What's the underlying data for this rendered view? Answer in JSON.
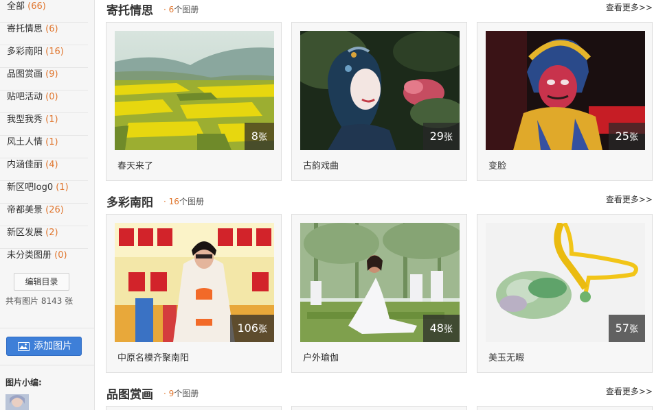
{
  "sidebar": {
    "categories": [
      {
        "label": "全部",
        "count": "(66)"
      },
      {
        "label": "寄托情思",
        "count": "(6)"
      },
      {
        "label": "多彩南阳",
        "count": "(16)"
      },
      {
        "label": "品图赏画",
        "count": "(9)"
      },
      {
        "label": "贴吧活动",
        "count": "(0)"
      },
      {
        "label": "我型我秀",
        "count": "(1)"
      },
      {
        "label": "风土人情",
        "count": "(1)"
      },
      {
        "label": "内涵佳丽",
        "count": "(4)"
      },
      {
        "label": "新区吧log0",
        "count": "(1)"
      },
      {
        "label": "帝都美景",
        "count": "(26)"
      },
      {
        "label": "新区发展",
        "count": "(2)"
      },
      {
        "label": "未分类图册",
        "count": "(0)"
      }
    ],
    "edit_label": "编辑目录",
    "total_text": "共有图片 8143 张",
    "add_label": "添加图片",
    "editor_title": "图片小编:"
  },
  "sections": [
    {
      "title": "寄托情思",
      "dot": "·",
      "count": "6",
      "count_suffix": "个图册",
      "more": "查看更多>>",
      "albums": [
        {
          "caption": "春天来了",
          "photos": "8",
          "unit": "张",
          "scene": "field"
        },
        {
          "caption": "古韵戏曲",
          "photos": "29",
          "unit": "张",
          "scene": "opera"
        },
        {
          "caption": "变脸",
          "photos": "25",
          "unit": "张",
          "scene": "mask"
        }
      ]
    },
    {
      "title": "多彩南阳",
      "dot": "·",
      "count": "16",
      "count_suffix": "个图册",
      "more": "查看更多>>",
      "albums": [
        {
          "caption": "中原名模齐聚南阳",
          "photos": "106",
          "unit": "张",
          "scene": "stage"
        },
        {
          "caption": "户外瑜伽",
          "photos": "48",
          "unit": "张",
          "scene": "yoga"
        },
        {
          "caption": "美玉无暇",
          "photos": "57",
          "unit": "张",
          "scene": "jade"
        }
      ]
    },
    {
      "title": "品图赏画",
      "dot": "·",
      "count": "9",
      "count_suffix": "个图册",
      "more": "查看更多>>"
    }
  ],
  "colors": {
    "accent": "#e0762e",
    "button_blue": "#3e7fd8"
  }
}
